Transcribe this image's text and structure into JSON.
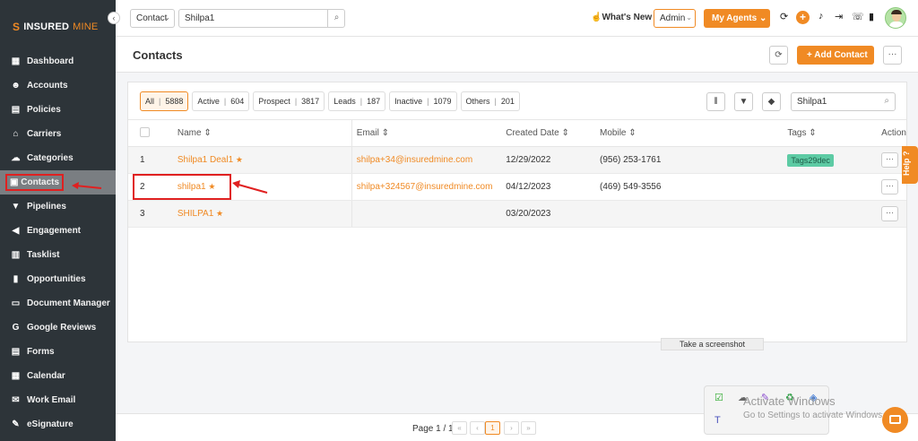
{
  "brand": {
    "name_bold": "INSURED",
    "name_light": "MINE"
  },
  "sidebar": {
    "items": [
      {
        "label": "Dashboard",
        "icon": "dashboard-icon"
      },
      {
        "label": "Accounts",
        "icon": "accounts-icon"
      },
      {
        "label": "Policies",
        "icon": "policies-icon"
      },
      {
        "label": "Carriers",
        "icon": "carriers-icon"
      },
      {
        "label": "Categories",
        "icon": "categories-icon"
      },
      {
        "label": "Contacts",
        "icon": "contacts-icon",
        "active": true
      },
      {
        "label": "Pipelines",
        "icon": "pipelines-icon"
      },
      {
        "label": "Engagement",
        "icon": "megaphone-icon"
      },
      {
        "label": "Tasklist",
        "icon": "tasklist-icon"
      },
      {
        "label": "Opportunities",
        "icon": "opportunities-icon"
      },
      {
        "label": "Document Manager",
        "icon": "folder-icon"
      },
      {
        "label": "Google Reviews",
        "icon": "google-icon"
      },
      {
        "label": "Forms",
        "icon": "forms-icon"
      },
      {
        "label": "Calendar",
        "icon": "calendar-icon"
      },
      {
        "label": "Work Email",
        "icon": "email-icon"
      },
      {
        "label": "eSignature",
        "icon": "signature-icon"
      }
    ]
  },
  "topbar": {
    "search_type": "Contact",
    "search_value": "Shilpa1",
    "whats_new": "What's New",
    "role": "Admin",
    "my_agents": "My Agents"
  },
  "page": {
    "title": "Contacts",
    "add_button": "+ Add Contact"
  },
  "filters": [
    {
      "label": "All",
      "count": "5888",
      "active": true
    },
    {
      "label": "Active",
      "count": "604"
    },
    {
      "label": "Prospect",
      "count": "3817"
    },
    {
      "label": "Leads",
      "count": "187"
    },
    {
      "label": "Inactive",
      "count": "1079"
    },
    {
      "label": "Others",
      "count": "201"
    }
  ],
  "table_search": "Shilpa1",
  "table": {
    "headers": {
      "name": "Name",
      "email": "Email",
      "created": "Created Date",
      "mobile": "Mobile",
      "tags": "Tags",
      "action": "Action"
    },
    "rows": [
      {
        "num": "1",
        "name": "Shilpa1 Deal1",
        "email": "shilpa+34@insuredmine.com",
        "created": "12/29/2022",
        "mobile": "(956) 253-1761",
        "tag": "Tags29dec"
      },
      {
        "num": "2",
        "name": "shilpa1",
        "email": "shilpa+324567@insuredmine.com",
        "created": "04/12/2023",
        "mobile": "(469) 549-3556",
        "tag": ""
      },
      {
        "num": "3",
        "name": "SHILPA1",
        "email": "",
        "created": "03/20/2023",
        "mobile": "",
        "tag": ""
      }
    ]
  },
  "help_tab": "Help",
  "screenshot_tip": "Take a screenshot",
  "pagination": {
    "label": "Page 1 / 1",
    "current": "1"
  },
  "watermark": {
    "line1": "Activate Windows",
    "line2": "Go to Settings to activate Windows."
  },
  "colors": {
    "accent": "#f08a24",
    "sidebar": "#2d3439",
    "highlight": "#e02020"
  }
}
